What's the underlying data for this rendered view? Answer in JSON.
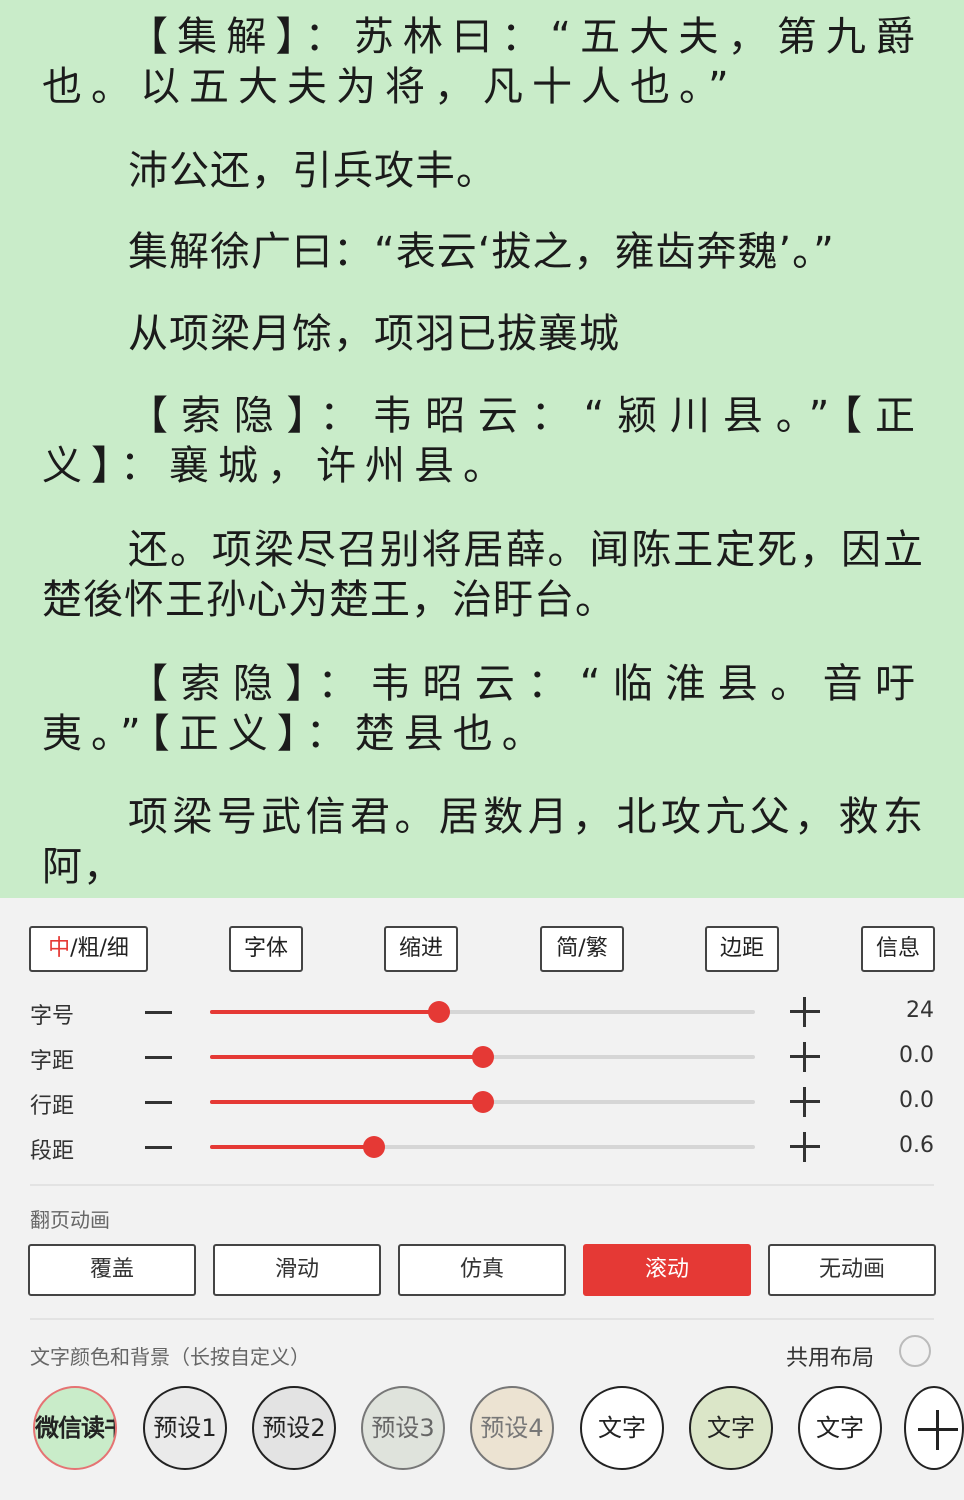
{
  "reader": {
    "paragraphs": [
      "【集解】：苏林曰：“五大夫，第九爵也。以五大夫为将，凡十人也。”",
      "沛公还，引兵攻丰。",
      "集解徐广曰：“表云‘拔之，雍齿奔魏’。”",
      "从项梁月馀，项羽已拔襄城",
      "【索隐】：韦昭云：“颍川县。”【正义】：襄城，许州县。",
      "还。项梁尽召别将居薛。闻陈王定死，因立楚後怀王孙心为楚王，治盱台。",
      "【索隐】：韦昭云：“临淮县。音吁夷。”【正义】：楚县也。",
      "项梁号武信君。居数月，北攻亢父，救东阿，"
    ]
  },
  "toolbar": {
    "weight_accent": "中",
    "weight_rest": "/粗/细",
    "font": "字体",
    "indent": "缩进",
    "simp_trad": "简/繁",
    "margin": "边距",
    "info": "信息"
  },
  "sliders": [
    {
      "label": "字号",
      "value": "24",
      "level": 0.42
    },
    {
      "label": "字距",
      "value": "0.0",
      "level": 0.5
    },
    {
      "label": "行距",
      "value": "0.0",
      "level": 0.5
    },
    {
      "label": "段距",
      "value": "0.6",
      "level": 0.3
    }
  ],
  "animation": {
    "title": "翻页动画",
    "options": [
      "覆盖",
      "滑动",
      "仿真",
      "滚动",
      "无动画"
    ],
    "selected": "滚动"
  },
  "colors": {
    "title": "文字颜色和背景（长按自定义）",
    "share_layout": "共用布局",
    "swatches": [
      "微信读书",
      "预设1",
      "预设2",
      "预设3",
      "预设4",
      "文字",
      "文字",
      "文字"
    ],
    "accent": "#e53935",
    "reader_bg": "#c9ecc9"
  }
}
